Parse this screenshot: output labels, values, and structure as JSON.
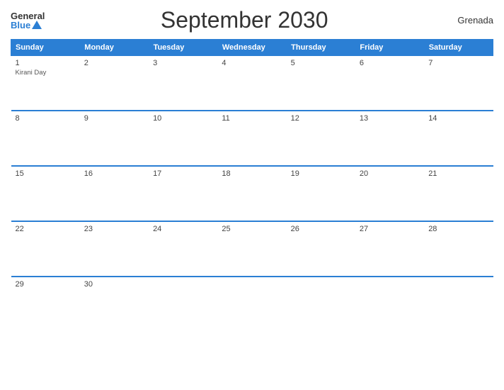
{
  "header": {
    "logo_general": "General",
    "logo_blue": "Blue",
    "title": "September 2030",
    "country": "Grenada"
  },
  "weekdays": [
    "Sunday",
    "Monday",
    "Tuesday",
    "Wednesday",
    "Thursday",
    "Friday",
    "Saturday"
  ],
  "weeks": [
    [
      {
        "day": "1",
        "holiday": "Kirani Day",
        "empty": false
      },
      {
        "day": "2",
        "holiday": "",
        "empty": false
      },
      {
        "day": "3",
        "holiday": "",
        "empty": false
      },
      {
        "day": "4",
        "holiday": "",
        "empty": false
      },
      {
        "day": "5",
        "holiday": "",
        "empty": false
      },
      {
        "day": "6",
        "holiday": "",
        "empty": false
      },
      {
        "day": "7",
        "holiday": "",
        "empty": false
      }
    ],
    [
      {
        "day": "8",
        "holiday": "",
        "empty": false
      },
      {
        "day": "9",
        "holiday": "",
        "empty": false
      },
      {
        "day": "10",
        "holiday": "",
        "empty": false
      },
      {
        "day": "11",
        "holiday": "",
        "empty": false
      },
      {
        "day": "12",
        "holiday": "",
        "empty": false
      },
      {
        "day": "13",
        "holiday": "",
        "empty": false
      },
      {
        "day": "14",
        "holiday": "",
        "empty": false
      }
    ],
    [
      {
        "day": "15",
        "holiday": "",
        "empty": false
      },
      {
        "day": "16",
        "holiday": "",
        "empty": false
      },
      {
        "day": "17",
        "holiday": "",
        "empty": false
      },
      {
        "day": "18",
        "holiday": "",
        "empty": false
      },
      {
        "day": "19",
        "holiday": "",
        "empty": false
      },
      {
        "day": "20",
        "holiday": "",
        "empty": false
      },
      {
        "day": "21",
        "holiday": "",
        "empty": false
      }
    ],
    [
      {
        "day": "22",
        "holiday": "",
        "empty": false
      },
      {
        "day": "23",
        "holiday": "",
        "empty": false
      },
      {
        "day": "24",
        "holiday": "",
        "empty": false
      },
      {
        "day": "25",
        "holiday": "",
        "empty": false
      },
      {
        "day": "26",
        "holiday": "",
        "empty": false
      },
      {
        "day": "27",
        "holiday": "",
        "empty": false
      },
      {
        "day": "28",
        "holiday": "",
        "empty": false
      }
    ],
    [
      {
        "day": "29",
        "holiday": "",
        "empty": false
      },
      {
        "day": "30",
        "holiday": "",
        "empty": false
      },
      {
        "day": "",
        "holiday": "",
        "empty": true
      },
      {
        "day": "",
        "holiday": "",
        "empty": true
      },
      {
        "day": "",
        "holiday": "",
        "empty": true
      },
      {
        "day": "",
        "holiday": "",
        "empty": true
      },
      {
        "day": "",
        "holiday": "",
        "empty": true
      }
    ]
  ]
}
